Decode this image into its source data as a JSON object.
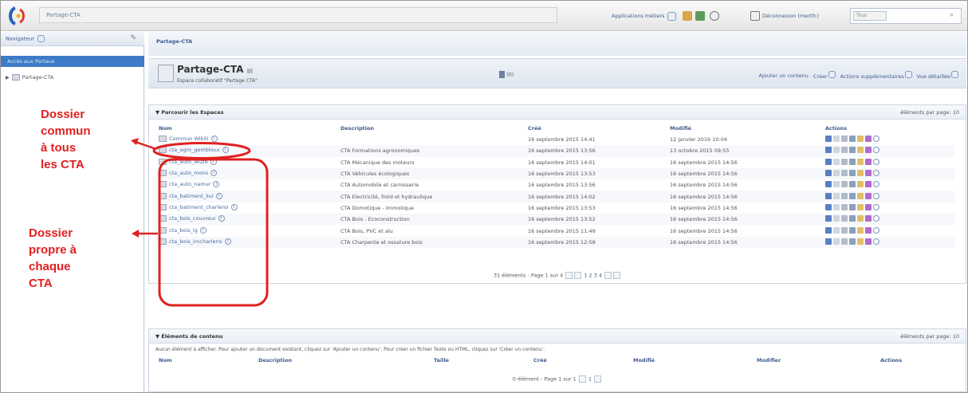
{
  "topbar": {
    "site_title": "Partage-CTA",
    "applications_label": "Applications métiers",
    "logout_label": "Déconnexion (mertfc)",
    "search_select": "Tous"
  },
  "sidebar": {
    "navigator_label": "Navigateur",
    "selected_label": "Accès aux Portaux",
    "tree_item": "Partage-CTA"
  },
  "annotations": {
    "common_folder": [
      "Dossier",
      "commun",
      "à tous",
      "les CTA"
    ],
    "own_folder": [
      "Dossier",
      "propre à",
      "chaque",
      "CTA"
    ]
  },
  "breadcrumb": "Partage-CTA",
  "space": {
    "title": "Partage-CTA",
    "subtitle": "Espace collaboratif \"Partage CTA\"",
    "count": "(0)",
    "add_content": "Ajouter un contenu",
    "create": "Créer",
    "more_actions": "Actions supplémentaires",
    "view_details": "Vue détaillée"
  },
  "spaces_panel": {
    "title": "Parcourir les Espaces",
    "per_page": "éléments par page: 10",
    "columns": [
      "Nom",
      "Description",
      "Créé",
      "Modifié",
      "Actions"
    ],
    "rows": [
      {
        "name": "Commun Wikiti",
        "description": "",
        "created": "16 septembre 2015 14:41",
        "modified": "12 janvier 2016 10:04"
      },
      {
        "name": "cta_agro_gembloux",
        "description": "CTA Formations agronomiques",
        "created": "16 septembre 2015 13:56",
        "modified": "13 octobre 2015 09:55"
      },
      {
        "name": "cta_auto_leuze",
        "description": "CTA Mécanique des moteurs",
        "created": "16 septembre 2015 14:01",
        "modified": "16 septembre 2015 14:56"
      },
      {
        "name": "cta_auto_mons",
        "description": "CTA Véhicules écologiques",
        "created": "16 septembre 2015 13:53",
        "modified": "16 septembre 2015 14:56"
      },
      {
        "name": "cta_auto_namur",
        "description": "CTA Automobile et carrosserie",
        "created": "16 septembre 2015 13:56",
        "modified": "16 septembre 2015 14:56"
      },
      {
        "name": "cta_batiment_liui",
        "description": "CTA Electricité, froid et hydraulique",
        "created": "16 septembre 2015 14:02",
        "modified": "16 septembre 2015 14:56"
      },
      {
        "name": "cta_batiment_charleroi",
        "description": "CTA Domotique - Immotique",
        "created": "16 septembre 2015 13:53",
        "modified": "16 septembre 2015 14:56"
      },
      {
        "name": "cta_bois_couvreur",
        "description": "CTA Bois - Ecoconstruction",
        "created": "16 septembre 2015 13:52",
        "modified": "16 septembre 2015 14:56"
      },
      {
        "name": "cta_bois_lg",
        "description": "CTA Bois, PVC et alu",
        "created": "16 septembre 2015 11:49",
        "modified": "16 septembre 2015 14:56"
      },
      {
        "name": "cta_bois_irncharleroi",
        "description": "CTA Charpente et ossature bois",
        "created": "16 septembre 2015 12:58",
        "modified": "16 septembre 2015 14:56"
      }
    ],
    "pager": "31 éléments - Page 1 sur 4",
    "pages": "1 2 3 4"
  },
  "content_panel": {
    "title": "Éléments de contenu",
    "per_page": "éléments par page: 10",
    "empty_message": "Aucun élément à afficher. Pour ajouter un document existant, cliquez sur 'Ajouter un contenu'. Pour créer un fichier Texte ou HTML, cliquez sur 'Créer un contenu'.",
    "columns": [
      "Nom",
      "Description",
      "Taille",
      "Créé",
      "Modifié",
      "Modifier",
      "Actions"
    ],
    "pager": "0 élément - Page 1 sur 1",
    "pages": "1"
  }
}
